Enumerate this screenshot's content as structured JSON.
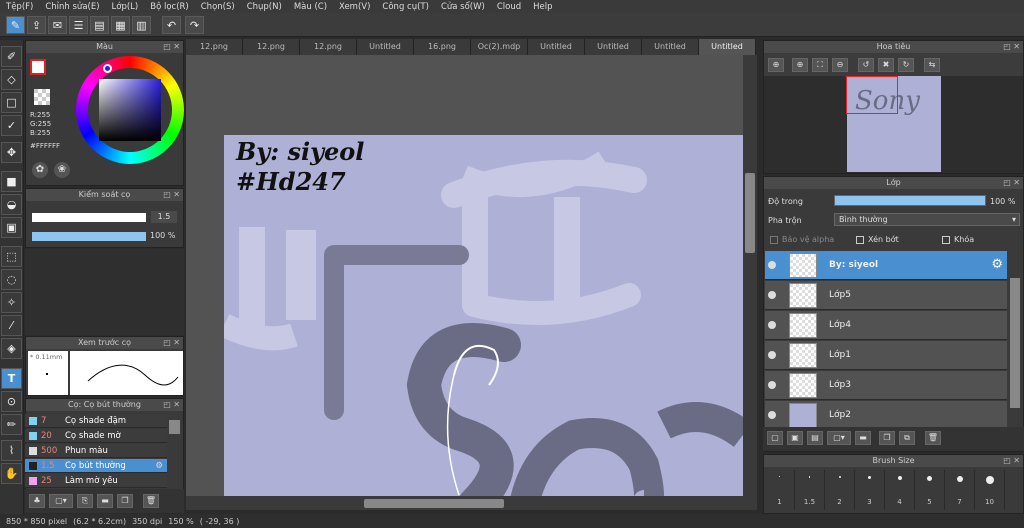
{
  "menu": [
    "Tệp(F)",
    "Chỉnh sửa(E)",
    "Lớp(L)",
    "Bộ lọc(R)",
    "Chọn(S)",
    "Chụp(N)",
    "Màu (C)",
    "Xem(V)",
    "Công cụ(T)",
    "Cửa sổ(W)",
    "Cloud",
    "Help"
  ],
  "tabs": [
    "12.png",
    "12.png",
    "12.png",
    "Untitled",
    "16.png",
    "Oc(2).mdp",
    "Untitled",
    "Untitled",
    "Untitled",
    "Untitled"
  ],
  "color_panel": {
    "title": "Màu",
    "r": "R:255",
    "g": "G:255",
    "b": "B:255",
    "hex": "#FFFFFF"
  },
  "brush_control": {
    "title": "Kiểm soát cọ",
    "size_value": "1.5",
    "opacity_value": "100 %",
    "opacity_fill": 1.0
  },
  "brush_preview": {
    "title": "Xem trước cọ",
    "size_label": "* 0.11mm"
  },
  "brush_list": {
    "title": "Cọ: Cọ bút thường",
    "items": [
      {
        "size": "7",
        "name": "Cọ shade đậm",
        "color": "#7fd3f0"
      },
      {
        "size": "20",
        "name": "Cọ shade mờ",
        "color": "#7fd3f0"
      },
      {
        "size": "500",
        "name": "Phun màu",
        "color": "#dddddd"
      },
      {
        "size": "1.5",
        "name": "Cọ bút thường",
        "color": "#222222"
      },
      {
        "size": "25",
        "name": "Làm mờ yếu",
        "color": "#f0a0f0"
      }
    ],
    "selected_index": 3
  },
  "navigator": {
    "title": "Hoa tiêu"
  },
  "layers": {
    "title": "Lớp",
    "opacity_label": "Độ trong",
    "opacity_value": "100 %",
    "blend_label": "Pha trộn",
    "blend_value": "Bình thường",
    "protect_alpha": "Bảo vệ alpha",
    "clipping": "Xén bớt",
    "lock": "Khóa",
    "items": [
      {
        "name": "By: siyeol",
        "selected": true
      },
      {
        "name": "Lớp5",
        "selected": false
      },
      {
        "name": "Lớp4",
        "selected": false
      },
      {
        "name": "Lớp1",
        "selected": false
      },
      {
        "name": "Lớp3",
        "selected": false
      },
      {
        "name": "Lớp2",
        "selected": false
      }
    ]
  },
  "brush_size": {
    "title": "Brush Size",
    "sizes": [
      "1",
      "1.5",
      "2",
      "3",
      "4",
      "5",
      "7",
      "10"
    ]
  },
  "canvas": {
    "text_line1": "By: siyeol",
    "text_line2": "#Hd247"
  },
  "status": {
    "dims": "850 * 850 pixel",
    "cm": "(6.2 * 6.2cm)",
    "dpi": "350 dpi",
    "zoom": "150 %",
    "coords": "( -29, 36 )"
  }
}
